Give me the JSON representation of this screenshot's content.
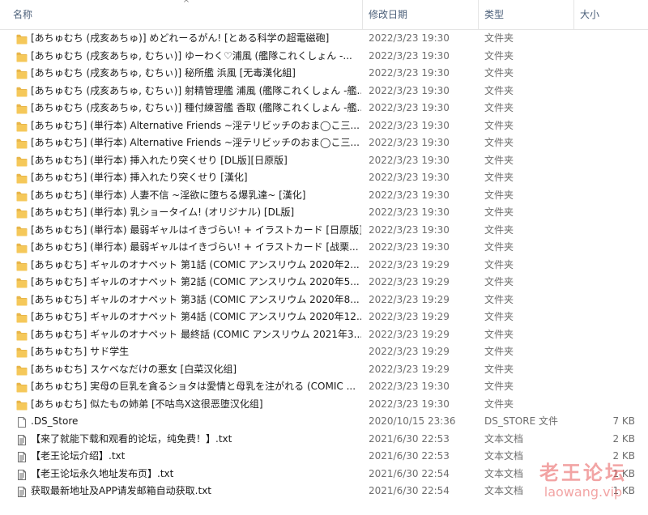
{
  "header": {
    "name": "名称",
    "date": "修改日期",
    "type": "类型",
    "size": "大小"
  },
  "icons": {
    "folder": "folder-icon",
    "file": "file-icon",
    "text": "text-file-icon",
    "folder_color": "#e8b64a"
  },
  "rows": [
    {
      "kind": "folder",
      "name": "[あちゅむち (戌亥あちゅ)] めどれーるがん! [とある科学の超電磁砲]",
      "date": "2022/3/23 19:30",
      "type": "文件夹",
      "size": ""
    },
    {
      "kind": "folder",
      "name": "[あちゅむち (戌亥あちゅ, むちぃ)] ゆーわく♡浦風 (艦隊これくしょん -...",
      "date": "2022/3/23 19:30",
      "type": "文件夹",
      "size": ""
    },
    {
      "kind": "folder",
      "name": "[あちゅむち (戌亥あちゅ, むちぃ)] 秘所艦 浜風 [无毒漢化組]",
      "date": "2022/3/23 19:30",
      "type": "文件夹",
      "size": ""
    },
    {
      "kind": "folder",
      "name": "[あちゅむち (戌亥あちゅ, むちぃ)] 射精管理艦 浦風 (艦隊これくしょん -艦...",
      "date": "2022/3/23 19:30",
      "type": "文件夹",
      "size": ""
    },
    {
      "kind": "folder",
      "name": "[あちゅむち (戌亥あちゅ, むちぃ)] 種付練習艦 香取 (艦隊これくしょん -艦...",
      "date": "2022/3/23 19:30",
      "type": "文件夹",
      "size": ""
    },
    {
      "kind": "folder",
      "name": "[あちゅむち] (単行本) Alternative Friends ~淫テリビッチのおま◯こ三...",
      "date": "2022/3/23 19:30",
      "type": "文件夹",
      "size": ""
    },
    {
      "kind": "folder",
      "name": "[あちゅむち] (単行本) Alternative Friends ~淫テリビッチのおま◯こ三...",
      "date": "2022/3/23 19:30",
      "type": "文件夹",
      "size": ""
    },
    {
      "kind": "folder",
      "name": "[あちゅむち] (単行本) 挿入れたり突くせり [DL版][日原版]",
      "date": "2022/3/23 19:30",
      "type": "文件夹",
      "size": ""
    },
    {
      "kind": "folder",
      "name": "[あちゅむち] (単行本) 挿入れたり突くせり [漢化]",
      "date": "2022/3/23 19:30",
      "type": "文件夹",
      "size": ""
    },
    {
      "kind": "folder",
      "name": "[あちゅむち] (単行本) 人妻不信 ~淫欲に堕ちる爆乳達~ [漢化]",
      "date": "2022/3/23 19:30",
      "type": "文件夹",
      "size": ""
    },
    {
      "kind": "folder",
      "name": "[あちゅむち] (単行本) 乳ショータイム! (オリジナル) [DL版]",
      "date": "2022/3/23 19:30",
      "type": "文件夹",
      "size": ""
    },
    {
      "kind": "folder",
      "name": "[あちゅむち] (単行本) 最弱ギャルはイきづらい! + イラストカード [日原版]",
      "date": "2022/3/23 19:30",
      "type": "文件夹",
      "size": ""
    },
    {
      "kind": "folder",
      "name": "[あちゅむち] (単行本) 最弱ギャルはイきづらい! + イラストカード [战栗...",
      "date": "2022/3/23 19:30",
      "type": "文件夹",
      "size": ""
    },
    {
      "kind": "folder",
      "name": "[あちゅむち] ギャルのオナペット 第1話 (COMIC アンスリウム 2020年2...",
      "date": "2022/3/23 19:29",
      "type": "文件夹",
      "size": ""
    },
    {
      "kind": "folder",
      "name": "[あちゅむち] ギャルのオナペット 第2話 (COMIC アンスリウム 2020年5...",
      "date": "2022/3/23 19:29",
      "type": "文件夹",
      "size": ""
    },
    {
      "kind": "folder",
      "name": "[あちゅむち] ギャルのオナペット 第3話 (COMIC アンスリウム 2020年8...",
      "date": "2022/3/23 19:29",
      "type": "文件夹",
      "size": ""
    },
    {
      "kind": "folder",
      "name": "[あちゅむち] ギャルのオナペット 第4話 (COMIC アンスリウム 2020年12...",
      "date": "2022/3/23 19:29",
      "type": "文件夹",
      "size": ""
    },
    {
      "kind": "folder",
      "name": "[あちゅむち] ギャルのオナペット 最終話 (COMIC アンスリウム 2021年3...",
      "date": "2022/3/23 19:29",
      "type": "文件夹",
      "size": ""
    },
    {
      "kind": "folder",
      "name": "[あちゅむち] サド学生",
      "date": "2022/3/23 19:29",
      "type": "文件夹",
      "size": ""
    },
    {
      "kind": "folder",
      "name": "[あちゅむち] スケベなだけの悪女 [白菜汉化组]",
      "date": "2022/3/23 19:29",
      "type": "文件夹",
      "size": ""
    },
    {
      "kind": "folder",
      "name": "[あちゅむち] 実母の巨乳を貪るショタは愛情と母乳を注がれる (COMIC ...",
      "date": "2022/3/23 19:30",
      "type": "文件夹",
      "size": ""
    },
    {
      "kind": "folder",
      "name": "[あちゅむち] 似たもの姉弟 [不咕鸟X这很恶堕汉化组]",
      "date": "2022/3/23 19:30",
      "type": "文件夹",
      "size": ""
    },
    {
      "kind": "file",
      "name": ".DS_Store",
      "date": "2020/10/15 23:36",
      "type": "DS_STORE 文件",
      "size": "7 KB"
    },
    {
      "kind": "text",
      "name": "【来了就能下载和观看的论坛，纯免费！】.txt",
      "date": "2021/6/30 22:53",
      "type": "文本文档",
      "size": "2 KB"
    },
    {
      "kind": "text",
      "name": "【老王论坛介绍】.txt",
      "date": "2021/6/30 22:53",
      "type": "文本文档",
      "size": "2 KB"
    },
    {
      "kind": "text",
      "name": "【老王论坛永久地址发布页】.txt",
      "date": "2021/6/30 22:54",
      "type": "文本文档",
      "size": "1 KB"
    },
    {
      "kind": "text",
      "name": "获取最新地址及APP请发邮箱自动获取.txt",
      "date": "2021/6/30 22:54",
      "type": "文本文档",
      "size": "1 KB"
    }
  ],
  "watermark": {
    "title": "老王论坛",
    "url": "laowang.vip"
  }
}
